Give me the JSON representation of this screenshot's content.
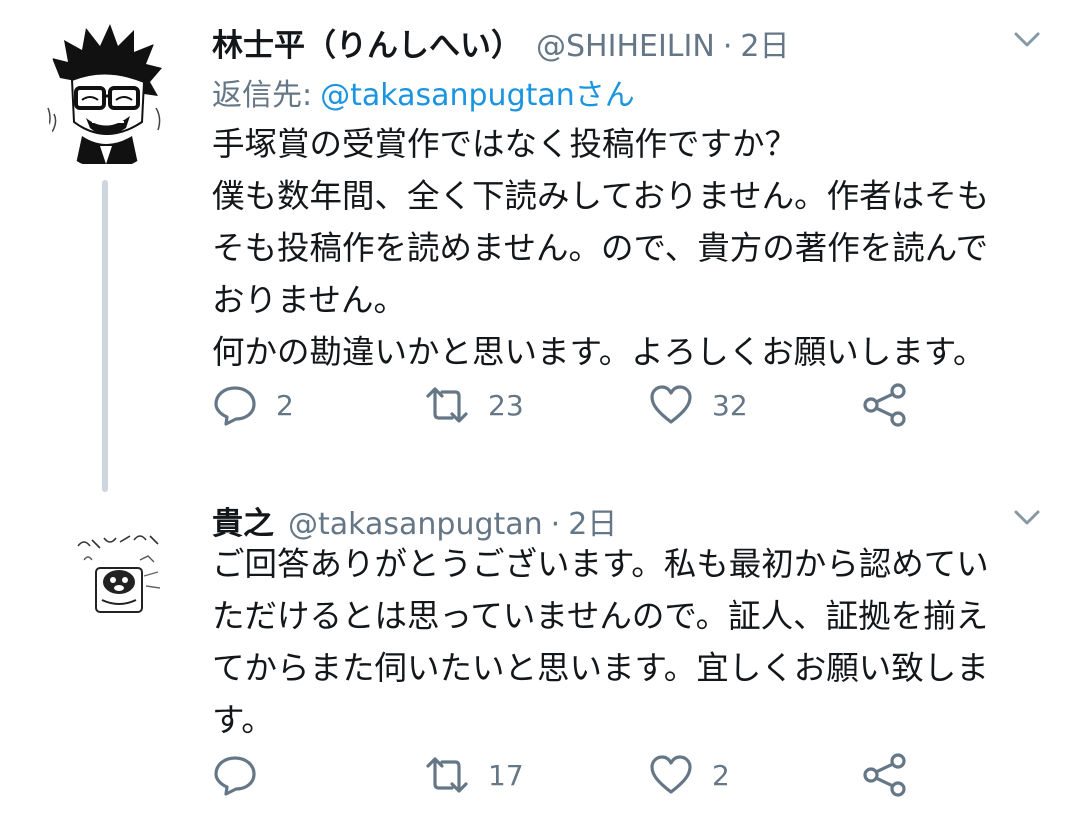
{
  "tweets": [
    {
      "name": "林士平（りんしへい）",
      "handle": "@SHIHEILIN",
      "separator": "·",
      "time": "2日",
      "reply_prefix": "返信先:",
      "reply_to": "@takasanpugtanさん",
      "body_lines": [
        "手塚賞の受賞作ではなく投稿作ですか？",
        "僕も数年間、全く下読みしておりません。作者はそも",
        "そも投稿作を読めません。ので、貴方の著作を読んで",
        "おりません。",
        "何かの勘違いかと思います。よろしくお願いします。"
      ],
      "replies": "2",
      "retweets": "23",
      "likes": "32"
    },
    {
      "name": "貴之",
      "handle": "@takasanpugtan",
      "separator": "·",
      "time": "2日",
      "body_lines": [
        "ご回答ありがとうございます。私も最初から認めてい",
        "ただけるとは思っていませんので。証人、証拠を揃え",
        "てからまた伺いたいと思います。宜しくお願い致しま",
        "す。"
      ],
      "replies": "",
      "retweets": "17",
      "likes": "2"
    }
  ],
  "colors": {
    "text": "#14171a",
    "secondary": "#657786",
    "link": "#1b95e0",
    "thread_line": "#ccd6dd"
  },
  "icons": [
    "reply-icon",
    "retweet-icon",
    "like-icon",
    "share-icon",
    "chevron-down-icon"
  ]
}
